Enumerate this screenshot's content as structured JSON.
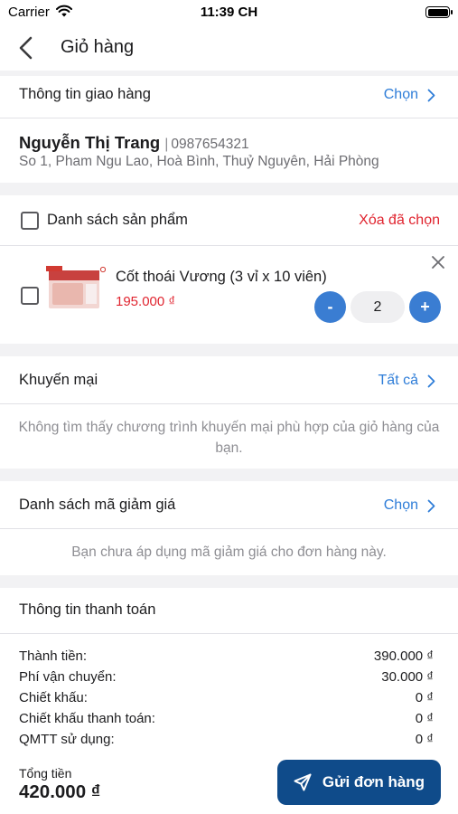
{
  "status_bar": {
    "carrier": "Carrier",
    "time": "11:39 CH"
  },
  "nav": {
    "title": "Giỏ hàng"
  },
  "shipping": {
    "title": "Thông tin giao hàng",
    "action": "Chọn",
    "name": "Nguyễn Thị Trang",
    "separator": "|",
    "phone": "0987654321",
    "address": "So 1, Pham Ngu Lao, Hoà Bình, Thuỷ Nguyên, Hải Phòng"
  },
  "products": {
    "title": "Danh sách sản phẩm",
    "clear_selected": "Xóa đã chọn",
    "items": [
      {
        "name": "Cốt thoái Vương (3 vỉ x 10 viên)",
        "price": "195.000 ₫",
        "quantity": "2",
        "minus": "-",
        "plus": "+"
      }
    ]
  },
  "promotions": {
    "title": "Khuyến mại",
    "action": "Tất cả",
    "empty_message": "Không tìm thấy chương trình khuyến mại phù hợp của giỏ hàng của bạn."
  },
  "coupons": {
    "title": "Danh sách mã giảm giá",
    "action": "Chọn",
    "empty_message": "Bạn chưa áp dụng mã giảm giá cho đơn hàng này."
  },
  "payment": {
    "title": "Thông tin thanh toán",
    "rows": [
      {
        "label": "Thành tiền:",
        "value": "390.000 ₫"
      },
      {
        "label": "Phí vận chuyển:",
        "value": "30.000 ₫"
      },
      {
        "label": "Chiết khấu:",
        "value": "0 ₫"
      },
      {
        "label": "Chiết khấu thanh toán:",
        "value": "0 ₫"
      },
      {
        "label": "QMTT sử dụng:",
        "value": "0 ₫"
      }
    ]
  },
  "footer": {
    "total_label": "Tổng tiền",
    "total_value": "420.000 ₫",
    "submit_label": "Gửi đơn hàng"
  },
  "colors": {
    "accent": "#2e7dd8",
    "danger": "#e0242f",
    "primary_button": "#0f4b8a",
    "section_gap": "#f2f2f4"
  },
  "icons": [
    "wifi-icon",
    "battery-icon",
    "back-chevron-icon",
    "chevron-right-icon",
    "close-icon",
    "send-icon"
  ]
}
